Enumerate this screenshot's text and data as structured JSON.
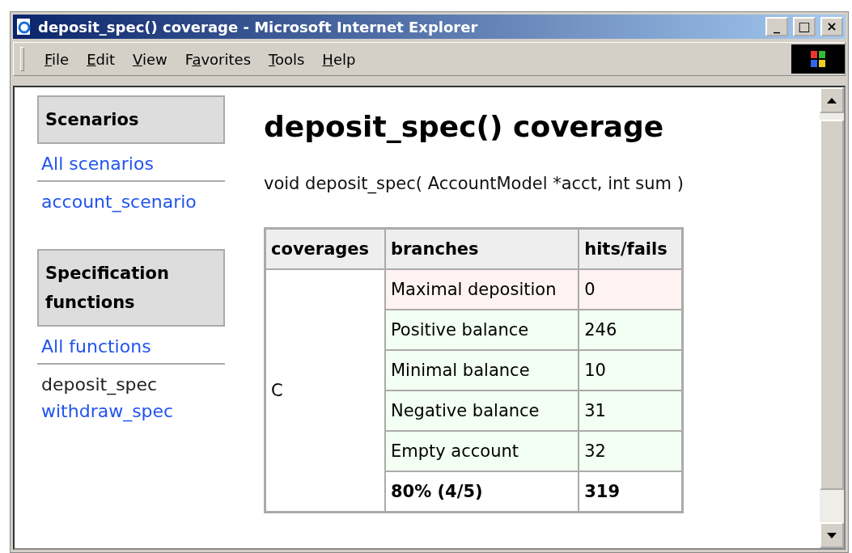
{
  "window": {
    "title": "deposit_spec() coverage - Microsoft Internet Explorer",
    "controls": [
      "_",
      "□",
      "×"
    ]
  },
  "menu": [
    {
      "access_key": "F",
      "after": "ile"
    },
    {
      "access_key": "E",
      "after": "dit"
    },
    {
      "access_key": "V",
      "after": "iew"
    },
    {
      "before": "F",
      "access_key": "a",
      "after": "vorites"
    },
    {
      "access_key": "T",
      "after": "ools"
    },
    {
      "access_key": "H",
      "after": "elp"
    }
  ],
  "sidebar": [
    {
      "heading": "Scenarios",
      "groups": [
        [
          {
            "label": "All scenarios",
            "selected": false
          }
        ],
        [
          {
            "label": "account_scenario",
            "selected": false
          }
        ]
      ]
    },
    {
      "heading": "Specification functions",
      "groups": [
        [
          {
            "label": "All functions",
            "selected": false
          }
        ],
        [
          {
            "label": "deposit_spec",
            "selected": true
          },
          {
            "label": "withdraw_spec",
            "selected": false
          }
        ]
      ]
    }
  ],
  "page": {
    "title": "deposit_spec() coverage",
    "signature": "void deposit_spec( AccountModel *acct, int sum )"
  },
  "table": {
    "columns": [
      "coverages",
      "branches",
      "hits/fails"
    ],
    "coverage": "C",
    "rows": [
      {
        "branch": "Maximal deposition",
        "hits": "0",
        "kind": "failed"
      },
      {
        "branch": "Positive balance",
        "hits": "246",
        "kind": "passed"
      },
      {
        "branch": "Minimal balance",
        "hits": "10",
        "kind": "passed"
      },
      {
        "branch": "Negative balance",
        "hits": "31",
        "kind": "passed"
      },
      {
        "branch": "Empty account",
        "hits": "32",
        "kind": "passed"
      },
      {
        "branch": "80% (4/5)",
        "hits": "319",
        "kind": "total"
      }
    ]
  }
}
